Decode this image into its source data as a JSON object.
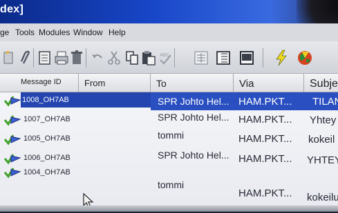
{
  "window": {
    "title": "dex]"
  },
  "menu": [
    "ge",
    "Tools",
    "Modules",
    "Window",
    "Help"
  ],
  "toolbar": {
    "icons": [
      "new-icon",
      "attach-icon",
      "print-preview-icon",
      "print-icon",
      "delete-icon",
      "undo-icon",
      "cut-icon",
      "copy-icon",
      "paste-icon",
      "spellcheck-icon",
      "list-view-icon",
      "detail-view-icon",
      "window-icon",
      "lightning-icon",
      "globe-icon"
    ]
  },
  "columns": [
    "Message ID",
    "From",
    "To",
    "Via",
    "Subje"
  ],
  "rows": [
    {
      "id": "1008_OH7AB",
      "to": "SPR Johto Hel...",
      "via": "HAM.PKT...",
      "subject": "TILAN",
      "selected": true
    },
    {
      "id": "1007_OH7AB",
      "to": "SPR Johto Hel...",
      "via": "HAM.PKT...",
      "subject": "Yhtey",
      "selected": false
    },
    {
      "id": "1005_OH7AB",
      "to": "tommi",
      "via": "HAM.PKT...",
      "subject": "kokeil",
      "selected": false
    },
    {
      "id": "1006_OH7AB",
      "to": "SPR Johto Hel...",
      "via": "HAM.PKT...",
      "subject": "YHTEY",
      "selected": false
    },
    {
      "id": "1004_OH7AB",
      "to": "tommi",
      "via": "HAM.PKT...",
      "subject": "kokeilu",
      "selected": false
    }
  ],
  "colors": {
    "title_bar": "#1846c8",
    "selection": "#2a4fc0",
    "check": "#3fa02a",
    "envelope": "#3a5fd0"
  }
}
